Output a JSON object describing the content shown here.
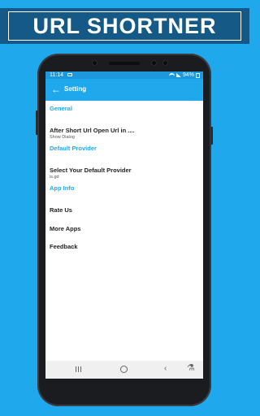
{
  "banner": {
    "title": "URL SHORTNER"
  },
  "statusbar": {
    "time": "11:14",
    "battery": "94%"
  },
  "appbar": {
    "title": "Setting"
  },
  "settings": {
    "general_header": "General",
    "open_url_title": "After Short Url Open Url in ....",
    "open_url_summary": "Show Dialog",
    "default_provider_header": "Default Provider",
    "select_provider_title": "Select Your Default Provider",
    "select_provider_summary": "is.gd",
    "app_info_header": "App Info",
    "rate_us": "Rate Us",
    "more_apps": "More Apps",
    "feedback": "Feedback"
  },
  "icons": {
    "back": "arrow-left-icon",
    "recent_apps": "recent-apps-icon",
    "home": "home-circle-icon",
    "nav_back": "chevron-left-icon",
    "accessibility": "accessibility-icon"
  },
  "colors": {
    "accent": "#1fa8ec",
    "banner": "#155a86",
    "phone": "#1b1c20"
  }
}
